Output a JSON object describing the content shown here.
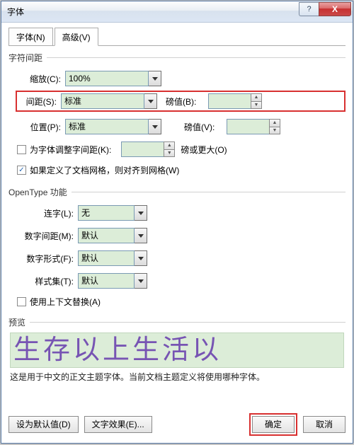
{
  "window": {
    "title": "字体"
  },
  "winbtns": {
    "help": "?",
    "close": "X"
  },
  "tabs": {
    "font": "字体(N)",
    "advanced": "高级(V)"
  },
  "section1": {
    "legend": "字符间距",
    "scale": {
      "label": "缩放(C):",
      "value": "100%"
    },
    "spacing": {
      "label": "间距(S):",
      "value": "标准",
      "pt_label": "磅值(B):",
      "pt_value": ""
    },
    "position": {
      "label": "位置(P):",
      "value": "标准",
      "pt_label": "磅值(V):",
      "pt_value": ""
    },
    "kerning": {
      "label": "为字体调整字间距(K):",
      "value": "",
      "suffix": "磅或更大(O)"
    },
    "snap": {
      "label": "如果定义了文档网格，则对齐到网格(W)"
    }
  },
  "section2": {
    "legend": "OpenType 功能",
    "ligature": {
      "label": "连字(L):",
      "value": "无"
    },
    "numspacing": {
      "label": "数字间距(M):",
      "value": "默认"
    },
    "numform": {
      "label": "数字形式(F):",
      "value": "默认"
    },
    "styleset": {
      "label": "样式集(T):",
      "value": "默认"
    },
    "context": {
      "label": "使用上下文替换(A)"
    }
  },
  "preview": {
    "legend": "预览",
    "sample": "生存以上生活以",
    "desc": "这是用于中文的正文主题字体。当前文档主题定义将使用哪种字体。"
  },
  "footer": {
    "default": "设为默认值(D)",
    "effects": "文字效果(E)...",
    "ok": "确定",
    "cancel": "取消"
  }
}
